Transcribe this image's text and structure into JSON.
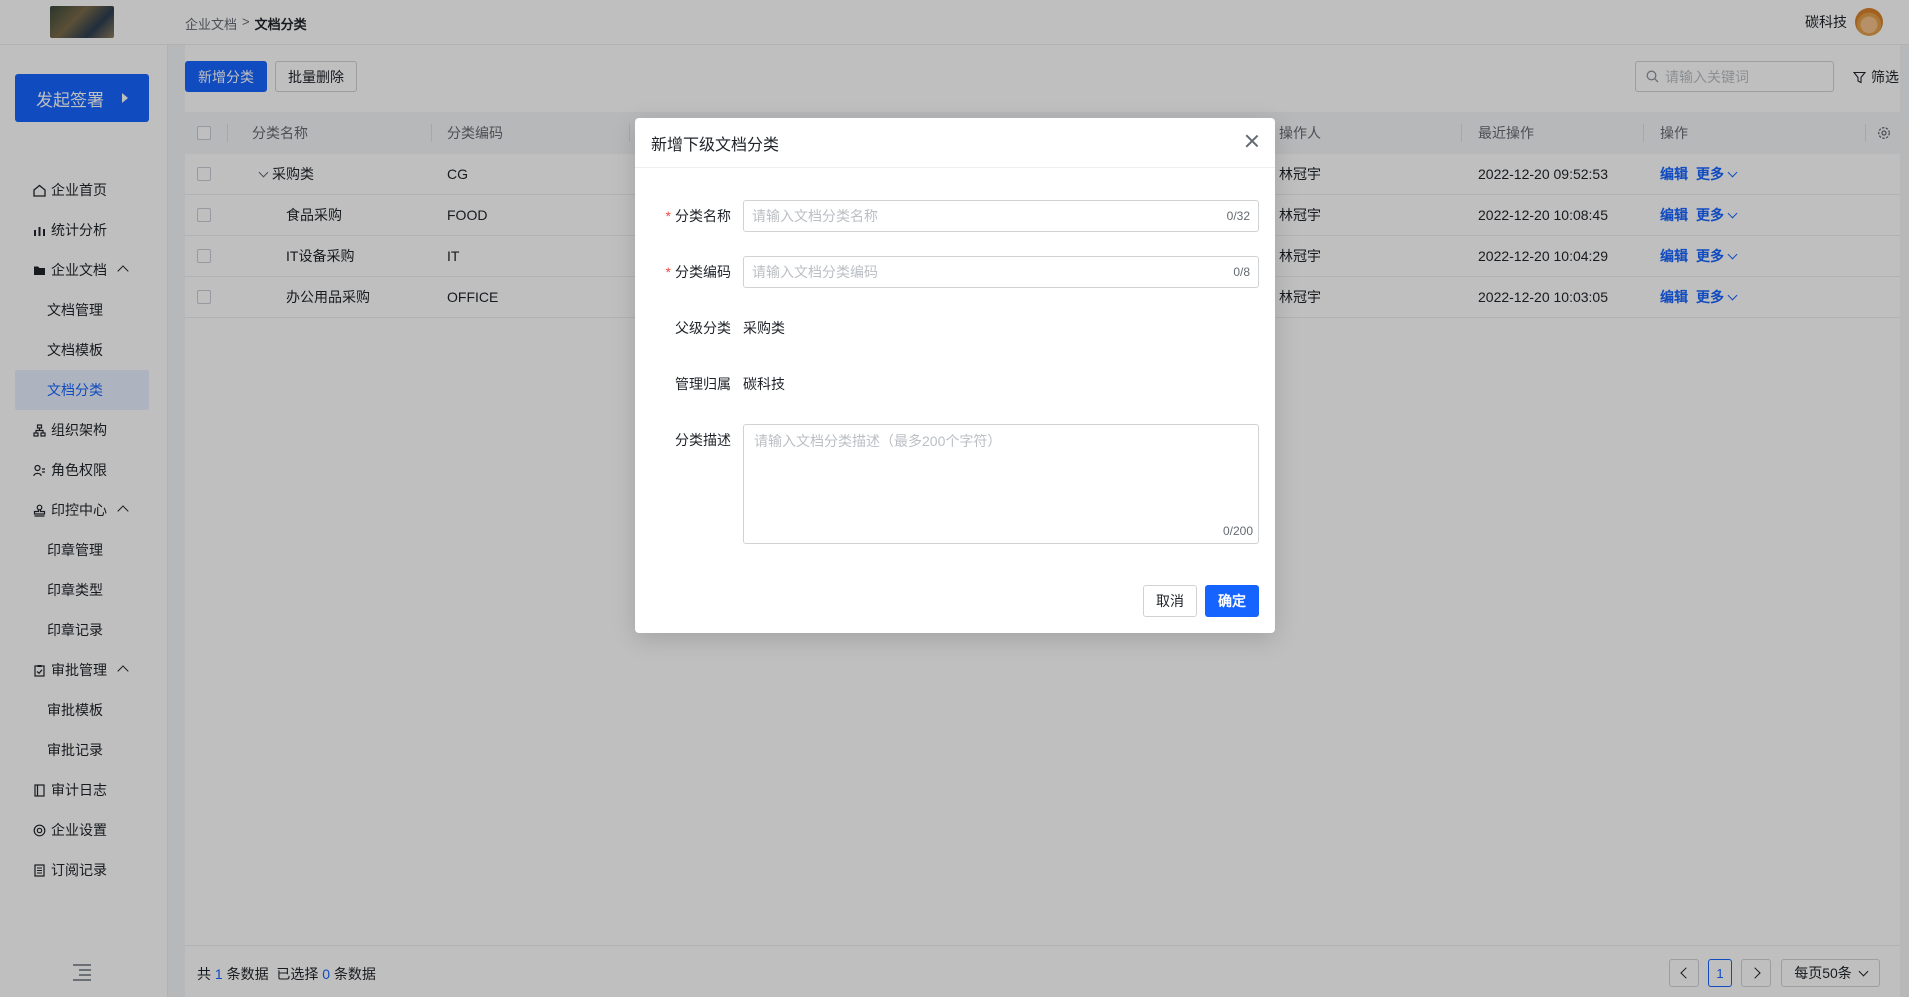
{
  "header": {
    "breadcrumb": [
      "企业文档",
      ">",
      "文档分类"
    ],
    "company": "碳科技"
  },
  "sidebar": {
    "start_button": "发起签署",
    "items": [
      {
        "label": "企业首页",
        "icon": "home-icon"
      },
      {
        "label": "统计分析",
        "icon": "chart-icon"
      },
      {
        "label": "企业文档",
        "icon": "folder-icon",
        "expanded": true
      },
      {
        "label": "文档管理"
      },
      {
        "label": "文档模板"
      },
      {
        "label": "文档分类",
        "active": true
      },
      {
        "label": "组织架构",
        "icon": "org-icon"
      },
      {
        "label": "角色权限",
        "icon": "role-icon"
      },
      {
        "label": "印控中心",
        "icon": "stamp-icon",
        "expanded": true
      },
      {
        "label": "印章管理"
      },
      {
        "label": "印章类型"
      },
      {
        "label": "印章记录"
      },
      {
        "label": "审批管理",
        "icon": "approval-icon",
        "expanded": true
      },
      {
        "label": "审批模板"
      },
      {
        "label": "审批记录"
      },
      {
        "label": "审计日志",
        "icon": "audit-icon"
      },
      {
        "label": "企业设置",
        "icon": "settings-icon"
      },
      {
        "label": "订阅记录",
        "icon": "subscribe-icon"
      }
    ]
  },
  "toolbar": {
    "add_label": "新增分类",
    "batch_delete_label": "批量删除",
    "search_placeholder": "请输入关键词",
    "filter_label": "筛选"
  },
  "table": {
    "columns": [
      "分类名称",
      "分类编码",
      "操作人",
      "最近操作",
      "操作"
    ],
    "rows": [
      {
        "name": "采购类",
        "code": "CG",
        "operator": "林冠宇",
        "time": "2022-12-20 09:52:53",
        "parent": true
      },
      {
        "name": "食品采购",
        "code": "FOOD",
        "operator": "林冠宇",
        "time": "2022-12-20 10:08:45"
      },
      {
        "name": "IT设备采购",
        "code": "IT",
        "operator": "林冠宇",
        "time": "2022-12-20 10:04:29"
      },
      {
        "name": "办公用品采购",
        "code": "OFFICE",
        "operator": "林冠宇",
        "time": "2022-12-20 10:03:05"
      }
    ],
    "edit_label": "编辑",
    "more_label": "更多"
  },
  "footer": {
    "total_prefix": "共",
    "total": "1",
    "total_suffix": "条数据",
    "selected_prefix": "已选择",
    "selected": "0",
    "selected_suffix": "条数据",
    "page": "1",
    "page_size": "每页50条"
  },
  "modal": {
    "title": "新增下级文档分类",
    "fields": {
      "name_label": "分类名称",
      "name_placeholder": "请输入文档分类名称",
      "name_counter": "0/32",
      "code_label": "分类编码",
      "code_placeholder": "请输入文档分类编码",
      "code_counter": "0/8",
      "parent_label": "父级分类",
      "parent_value": "采购类",
      "owner_label": "管理归属",
      "owner_value": "碳科技",
      "desc_label": "分类描述",
      "desc_placeholder": "请输入文档分类描述（最多200个字符）",
      "desc_counter": "0/200"
    },
    "cancel_label": "取消",
    "confirm_label": "确定"
  },
  "colors": {
    "primary": "#1664ff",
    "danger": "#f54a45"
  }
}
